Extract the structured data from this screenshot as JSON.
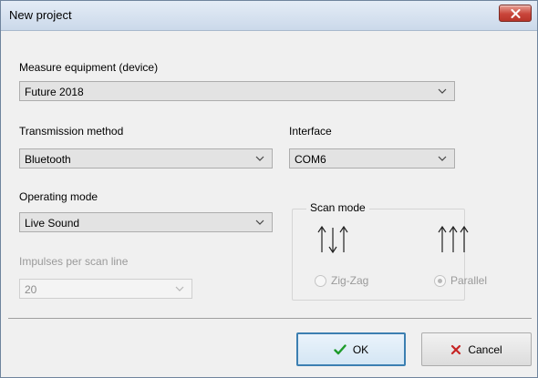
{
  "window": {
    "title": "New project"
  },
  "device": {
    "label": "Measure equipment (device)",
    "value": "Future 2018"
  },
  "transmission": {
    "label": "Transmission method",
    "value": "Bluetooth"
  },
  "interface": {
    "label": "Interface",
    "value": "COM6"
  },
  "operating_mode": {
    "label": "Operating mode",
    "value": "Live Sound"
  },
  "impulses": {
    "label": "Impulses per scan line",
    "value": "20"
  },
  "scan_mode": {
    "title": "Scan mode",
    "options": [
      {
        "label": "Zig-Zag",
        "selected": false
      },
      {
        "label": "Parallel",
        "selected": true
      }
    ]
  },
  "buttons": {
    "ok": "OK",
    "cancel": "Cancel"
  },
  "icons": {
    "close": "close-icon",
    "chevron": "chevron-down-icon",
    "zigzag": "zigzag-arrows-icon",
    "parallel": "parallel-arrows-icon",
    "check": "checkmark-icon",
    "cancel": "x-icon"
  },
  "colors": {
    "close_button": "#c9453a",
    "ok_check": "#1e9b2a",
    "cancel_x": "#c62424",
    "default_button_border": "#3c7fb1"
  }
}
